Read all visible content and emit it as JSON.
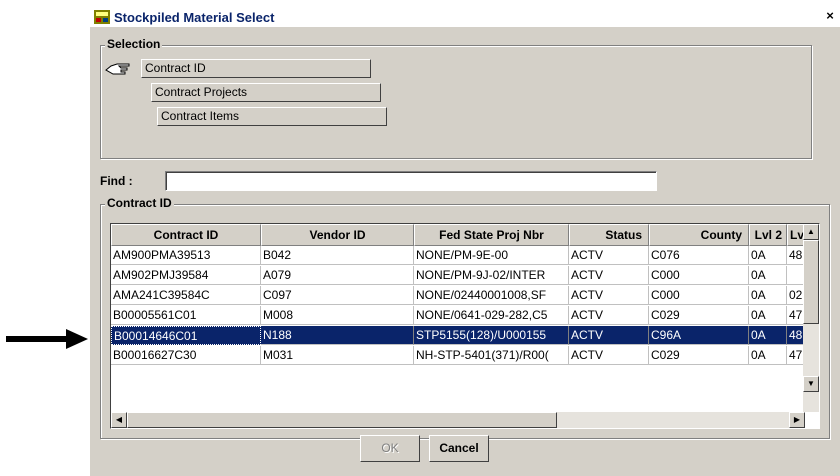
{
  "window": {
    "title": "Stockpiled Material Select",
    "close_glyph": "×"
  },
  "selection": {
    "label": "Selection",
    "items": [
      "Contract ID",
      "Contract Projects",
      "Contract Items"
    ],
    "pointer_icon": "hand-pointer-icon"
  },
  "find": {
    "label": "Find :",
    "value": ""
  },
  "grid": {
    "label": "Contract ID",
    "columns": [
      "Contract ID",
      "Vendor ID",
      "Fed State Proj Nbr",
      "Status",
      "County",
      "Lvl 2",
      "Lv"
    ],
    "rows": [
      [
        "AM900PMA39513",
        "B042",
        "NONE/PM-9E-00",
        "ACTV",
        "C076",
        "0A",
        "48"
      ],
      [
        "AM902PMJ39584",
        "A079",
        "NONE/PM-9J-02/INTER",
        "ACTV",
        "C000",
        "0A",
        ""
      ],
      [
        "AMA241C39584C",
        "C097",
        "NONE/02440001008,SF",
        "ACTV",
        "C000",
        "0A",
        "02"
      ],
      [
        "B00005561C01",
        "M008",
        "NONE/0641-029-282,C5",
        "ACTV",
        "C029",
        "0A",
        "47"
      ],
      [
        "B00014646C01",
        "N188",
        "STP5155(128)/U000155",
        "ACTV",
        "C96A",
        "0A",
        "48"
      ],
      [
        "B00016627C30",
        "M031",
        "NH-STP-5401(371)/R00(",
        "ACTV",
        "C029",
        "0A",
        "47"
      ]
    ],
    "selected_row": 4
  },
  "buttons": {
    "ok": "OK",
    "cancel": "Cancel"
  },
  "colors": {
    "selection": "#0a246a",
    "face": "#d4d0c8"
  }
}
